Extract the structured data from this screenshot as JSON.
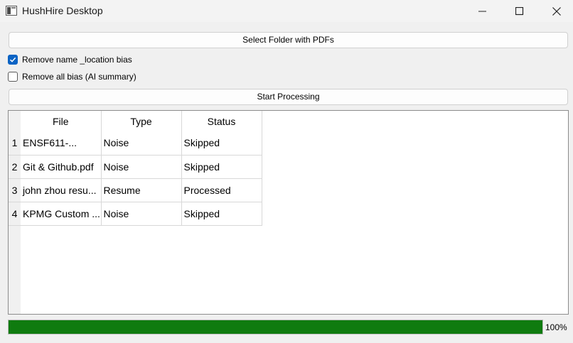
{
  "window": {
    "title": "HushHire Desktop"
  },
  "controls": {
    "select_folder_label": "Select Folder with PDFs",
    "remove_name_location_label": "Remove name _location bias",
    "remove_name_location_checked": true,
    "remove_all_bias_label": "Remove all bias (AI summary)",
    "remove_all_bias_checked": false,
    "start_processing_label": "Start Processing"
  },
  "table": {
    "columns": [
      "File",
      "Type",
      "Status"
    ],
    "rows": [
      {
        "num": "1",
        "file": "ENSF611-...",
        "type": "Noise",
        "status": "Skipped"
      },
      {
        "num": "2",
        "file": "Git & Github.pdf",
        "type": "Noise",
        "status": "Skipped"
      },
      {
        "num": "3",
        "file": "john zhou resu...",
        "type": "Resume",
        "status": "Processed"
      },
      {
        "num": "4",
        "file": "KPMG Custom ...",
        "type": "Noise",
        "status": "Skipped"
      }
    ]
  },
  "progress": {
    "value": 100,
    "text": "100%",
    "color": "#0f7b0f"
  },
  "colors": {
    "accent": "#0b63c4"
  }
}
